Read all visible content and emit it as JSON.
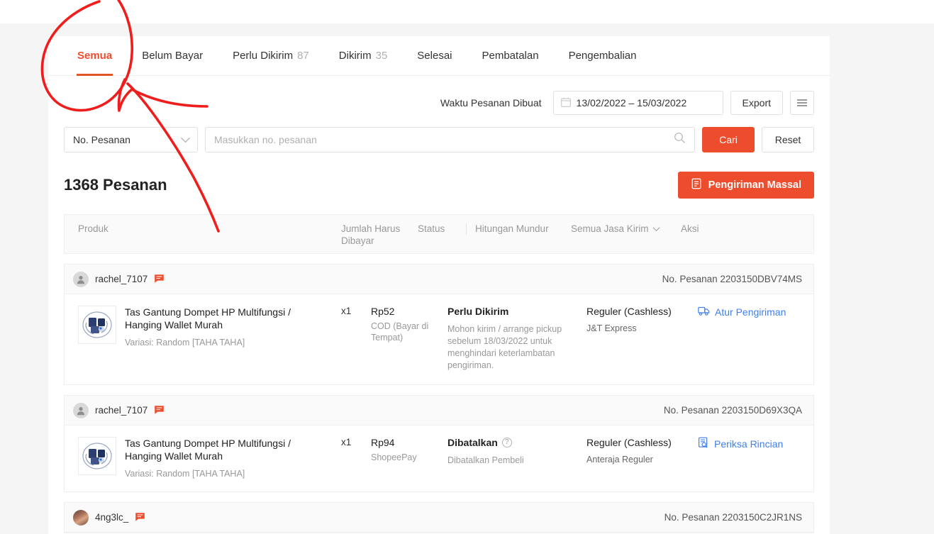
{
  "colors": {
    "accent": "#ee4d2d",
    "tab_underline": "#e25527",
    "link": "#4080ee",
    "annotation": "#f01d1d",
    "page_bg": "#f5f5f5",
    "card_bg": "#ffffff",
    "header_bg": "#fafafa"
  },
  "tabs": [
    {
      "label": "Semua",
      "count": "",
      "active": true
    },
    {
      "label": "Belum Bayar",
      "count": "",
      "active": false
    },
    {
      "label": "Perlu Dikirim",
      "count": "87",
      "active": false
    },
    {
      "label": "Dikirim",
      "count": "35",
      "active": false
    },
    {
      "label": "Selesai",
      "count": "",
      "active": false
    },
    {
      "label": "Pembatalan",
      "count": "",
      "active": false
    },
    {
      "label": "Pengembalian",
      "count": "",
      "active": false
    }
  ],
  "filters": {
    "date_label": "Waktu Pesanan Dibuat",
    "date_value": "13/02/2022 – 15/03/2022",
    "calendar_icon": "calendar-icon",
    "export_label": "Export",
    "more_icon": "hamburger-menu-icon",
    "select_value": "No. Pesanan",
    "select_chevron": "chevron-down-icon",
    "search_placeholder": "Masukkan no. pesanan",
    "search_value": "",
    "search_icon": "search-icon",
    "search_button": "Cari",
    "reset_button": "Reset"
  },
  "summary": {
    "count_title": "1368 Pesanan",
    "bulk_button": "Pengiriman Massal",
    "bulk_icon": "printer-icon"
  },
  "table_headers": {
    "produk": "Produk",
    "jumlah": "Jumlah Harus Dibayar",
    "status": "Status",
    "mundur": "Hitungan Mundur",
    "jasa_kirim": "Semua Jasa Kirim",
    "jasa_chevron": "chevron-down-icon",
    "aksi": "Aksi"
  },
  "orders": [
    {
      "username": "rachel_7107",
      "avatar_type": "silhouette",
      "chat_icon": "chat-bubble-icon",
      "order_no_label": "No. Pesanan",
      "order_no": "2203150DBV74MS",
      "product_title": "Tas Gantung Dompet HP Multifungsi / Hanging Wallet Murah",
      "product_variation": "Variasi: Random [TAHA TAHA]",
      "product_image": "product-thumbnail-blue-bag",
      "qty": "x1",
      "amount": "Rp52",
      "payment_method": "COD (Bayar di Tempat)",
      "status": "Perlu Dikirim",
      "status_help": false,
      "status_note": "Mohon kirim / arrange pickup sebelum 18/03/2022 untuk menghindari keterlambatan pengiriman.",
      "shipping_type": "Reguler (Cashless)",
      "courier": "J&T Express",
      "action_label": "Atur Pengiriman",
      "action_icon": "truck-icon"
    },
    {
      "username": "rachel_7107",
      "avatar_type": "silhouette",
      "chat_icon": "chat-bubble-icon",
      "order_no_label": "No. Pesanan",
      "order_no": "2203150D69X3QA",
      "product_title": "Tas Gantung Dompet HP Multifungsi / Hanging Wallet Murah",
      "product_variation": "Variasi: Random [TAHA TAHA]",
      "product_image": "product-thumbnail-blue-bag",
      "qty": "x1",
      "amount": "Rp94",
      "payment_method": "ShopeePay",
      "status": "Dibatalkan",
      "status_help": true,
      "status_note": "Dibatalkan Pembeli",
      "shipping_type": "Reguler (Cashless)",
      "courier": "Anteraja Reguler",
      "action_label": "Periksa Rincian",
      "action_icon": "document-search-icon"
    },
    {
      "username": "4ng3lc_",
      "avatar_type": "photo",
      "chat_icon": "chat-bubble-icon",
      "order_no_label": "No. Pesanan",
      "order_no": "2203150C2JR1NS",
      "product_title": "",
      "product_variation": "",
      "product_image": "",
      "qty": "",
      "amount": "",
      "payment_method": "",
      "status": "",
      "status_help": false,
      "status_note": "",
      "shipping_type": "",
      "courier": "",
      "action_label": "",
      "action_icon": ""
    }
  ],
  "annotation": {
    "name": "red-handdrawn-marks",
    "shapes": "ellipse-around-semua-tab, arrow-pointing-to-tab"
  }
}
